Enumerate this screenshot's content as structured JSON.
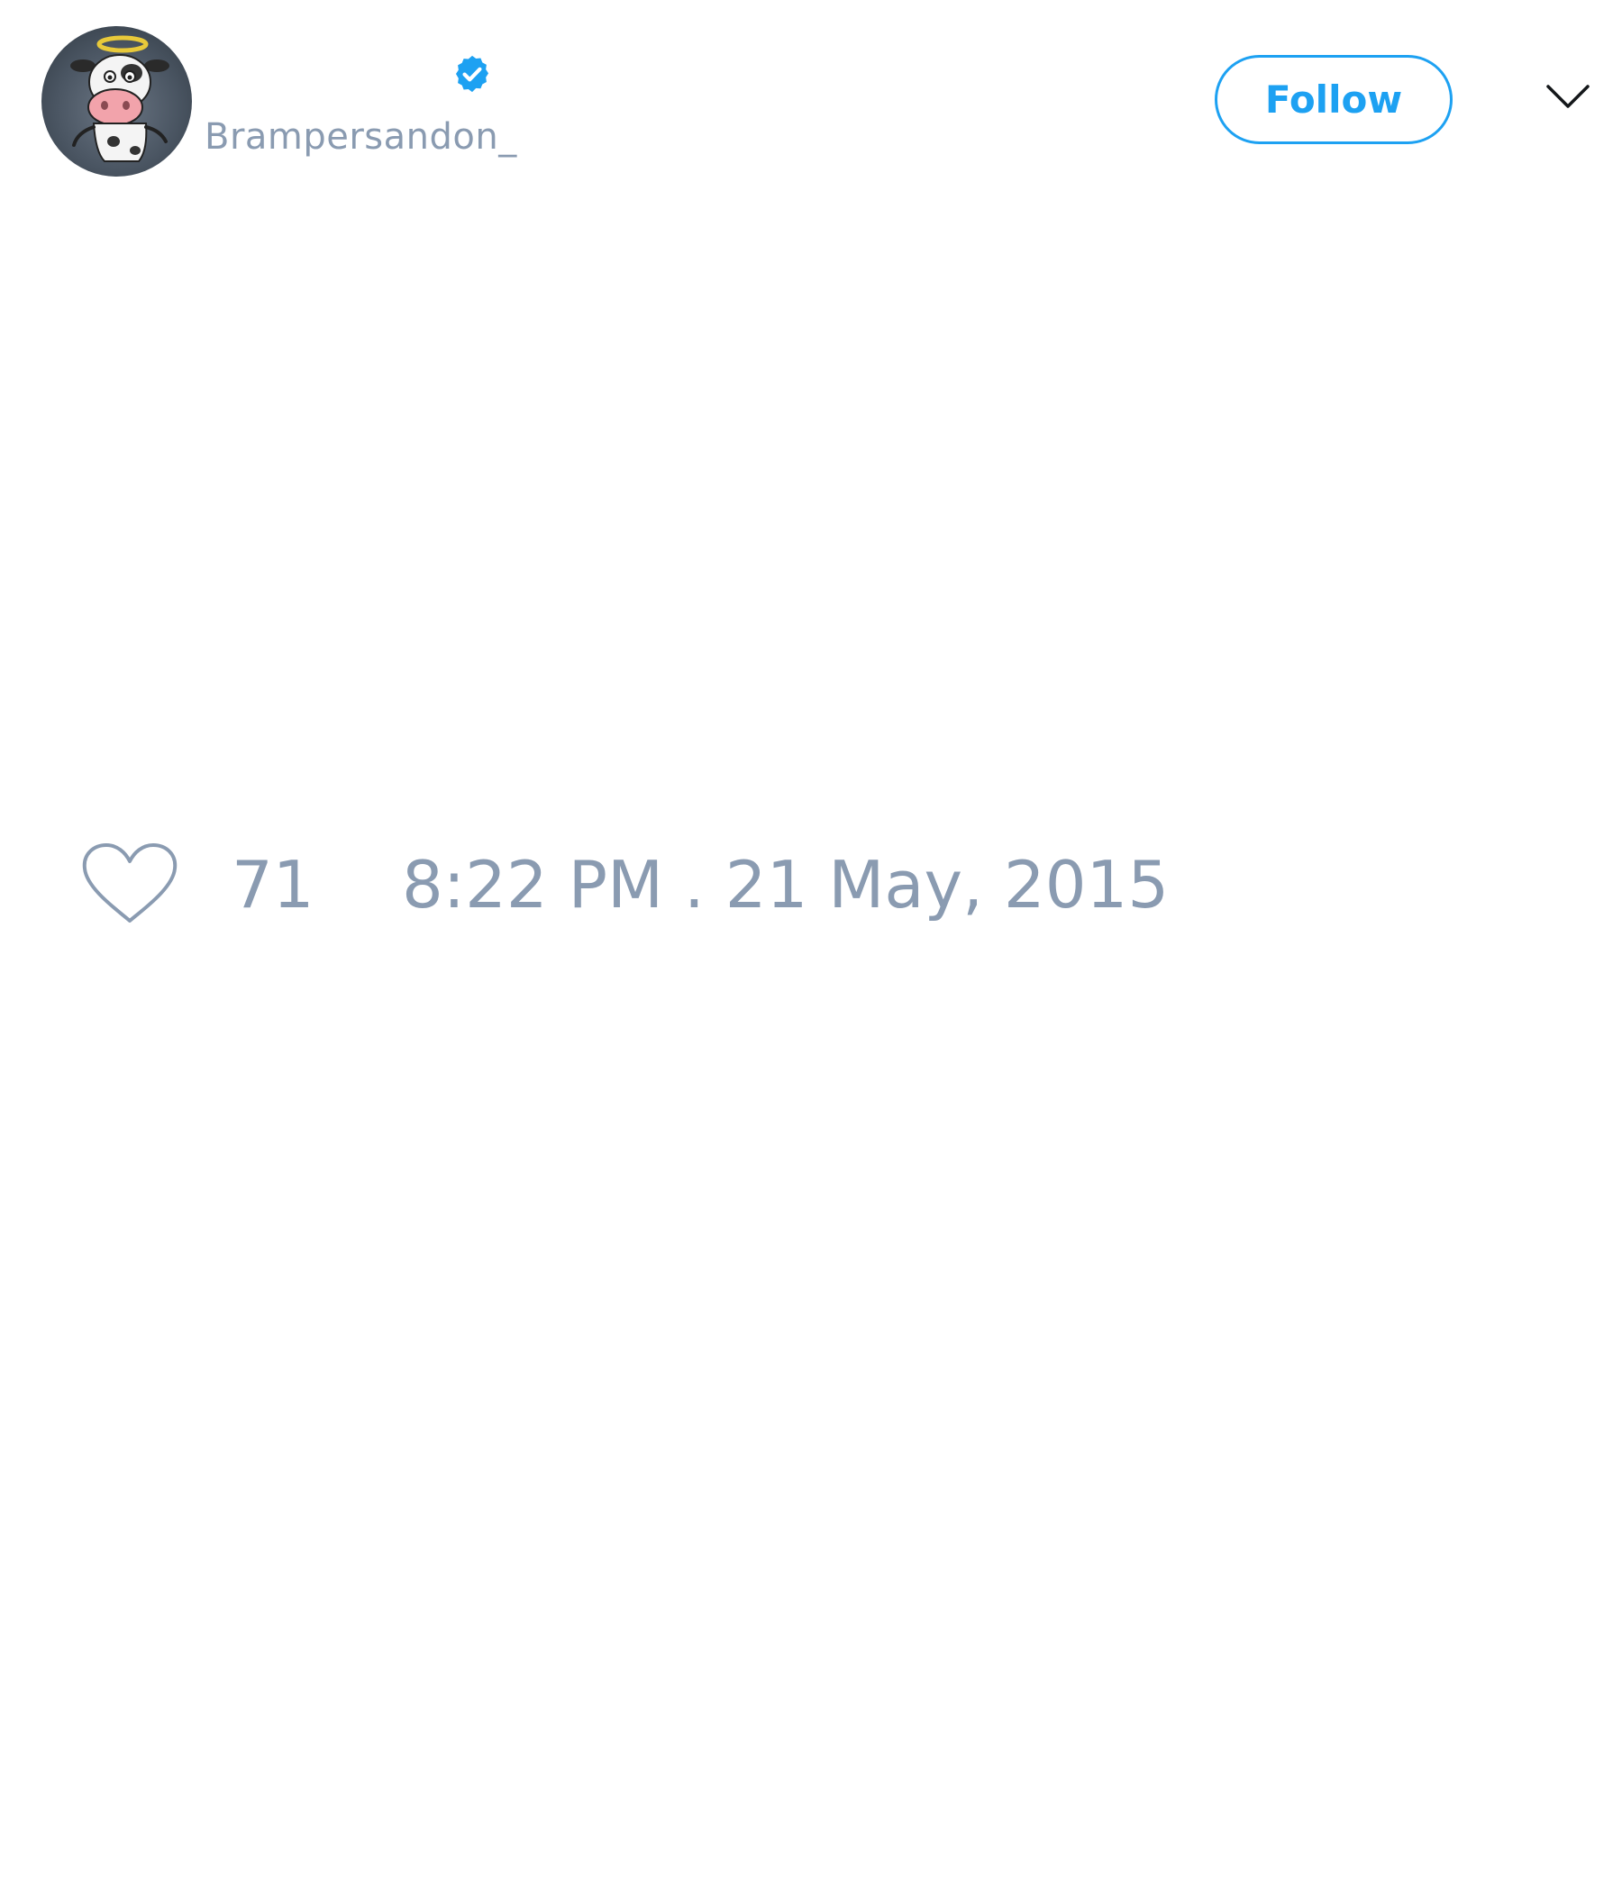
{
  "author": {
    "handle": "Brampersandon_",
    "verified": true,
    "avatar_icon": "cow-angel-avatar"
  },
  "header": {
    "follow_label": "Follow",
    "menu_icon": "chevron-down-icon"
  },
  "tweet": {
    "like_icon": "heart-icon",
    "like_count": "71",
    "timestamp": "8:22 PM . 21 May, 2015"
  },
  "colors": {
    "accent": "#1da1f2",
    "muted_text": "#8a9bb1",
    "background": "#ffffff"
  }
}
